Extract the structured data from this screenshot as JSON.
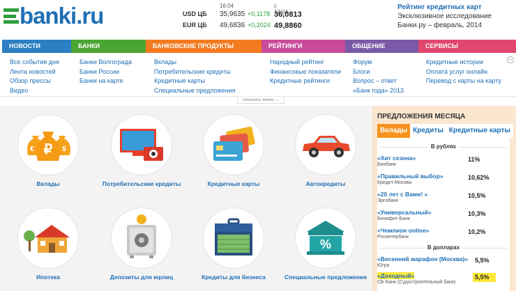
{
  "header": {
    "logo_text": "banki.ru",
    "rates": {
      "date_old": "16.04",
      "date_new": "с 17.04",
      "usd": {
        "name": "USD ЦБ",
        "old": "35,9635",
        "change": "+0,1178",
        "new": "36,0813"
      },
      "eur": {
        "name": "EUR ЦБ",
        "old": "49,6836",
        "change": "+0,2024",
        "new": "49,8860"
      }
    },
    "promo": {
      "title": "Рейтинг кредитных карт",
      "desc": "Эксклюзивное исследование Банки.ру – февраль, 2014"
    }
  },
  "nav": {
    "tabs": [
      {
        "label": "НОВОСТИ",
        "color": "#2b7fc2"
      },
      {
        "label": "БАНКИ",
        "color": "#4aa531"
      },
      {
        "label": "БАНКОВСКИЕ ПРОДУКТЫ",
        "color": "#f47a20"
      },
      {
        "label": "РЕЙТИНГИ",
        "color": "#c94b9a"
      },
      {
        "label": "ОБЩЕНИЕ",
        "color": "#7a5aa6"
      },
      {
        "label": "СЕРВИСЫ",
        "color": "#e0476e"
      }
    ],
    "columns": [
      [
        "Все события дня",
        "Лента новостей",
        "Обзор прессы",
        "Видео"
      ],
      [
        "Банки Волгограда",
        "Банки России",
        "Банки на карте"
      ],
      [
        "Вклады",
        "Потребительские кредиты",
        "Кредитные карты",
        "Специальные предложения"
      ],
      [
        "Народный рейтинг",
        "Финансовые показатели",
        "Кредитные рейтинги"
      ],
      [
        "Форум",
        "Блоги",
        "Вопрос – ответ",
        "«Банк года» 2013"
      ],
      [
        "Кредитные истории",
        "Оплата услуг онлайн",
        "Перевод с карты на карту"
      ]
    ],
    "show_menu": "показать меню"
  },
  "products": [
    {
      "label": "Вклады",
      "icon": "money-bags-icon"
    },
    {
      "label": "Потребительские кредиты",
      "icon": "tv-camera-icon"
    },
    {
      "label": "Кредитные карты",
      "icon": "credit-cards-icon"
    },
    {
      "label": "Автокредиты",
      "icon": "car-icon"
    },
    {
      "label": "Ипотека",
      "icon": "house-icon"
    },
    {
      "label": "Депозиты для юрлиц",
      "icon": "safe-icon"
    },
    {
      "label": "Кредиты для бизнеса",
      "icon": "briefcase-icon"
    },
    {
      "label": "Специальные предложения",
      "icon": "bank-percent-icon"
    }
  ],
  "offers": {
    "title": "ПРЕДЛОЖЕНИЯ МЕСЯЦА",
    "tabs": [
      "Вклады",
      "Кредиты",
      "Кредитные карты"
    ],
    "rub_label": "В рублях",
    "usd_label": "В долларах",
    "rub": [
      {
        "name": "«Хит сезона»",
        "bank": "Бинбанк",
        "rate": "11%"
      },
      {
        "name": "«Правильный выбор»",
        "bank": "Кредит-Москва",
        "rate": "10,62%"
      },
      {
        "name": "«20 лет с Вами! »",
        "bank": "Эргобанк",
        "rate": "10,5%"
      },
      {
        "name": "«Универсальный»",
        "bank": "Бенифит-Банк",
        "rate": "10,3%"
      },
      {
        "name": "«Чемпион online»",
        "bank": "Росинтербанк",
        "rate": "10,2%"
      }
    ],
    "usd": [
      {
        "name": "«Весенний марафон (Москва)»",
        "bank": "Югра",
        "rate": "5,5%"
      },
      {
        "name": "«Доходный»",
        "bank": "СБ Банк (Судостроительный банк)",
        "rate": "5,5%"
      }
    ]
  }
}
